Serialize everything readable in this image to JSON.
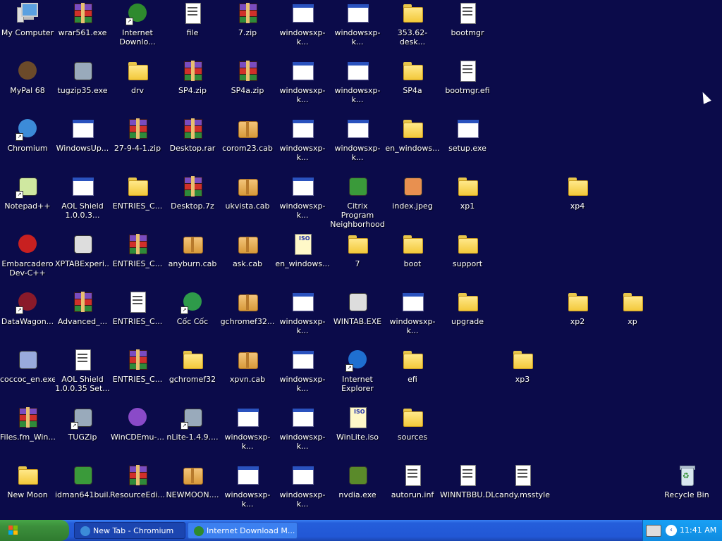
{
  "desktop": {
    "icons": [
      {
        "label": "My Computer",
        "type": "mycomp"
      },
      {
        "label": "wrar561.exe",
        "type": "rar"
      },
      {
        "label": "Internet\nDownlo...",
        "type": "circle",
        "color": "#2e8a2e",
        "shortcut": true
      },
      {
        "label": "file",
        "type": "doc"
      },
      {
        "label": "7.zip",
        "type": "rar"
      },
      {
        "label": "windowsxp-k...",
        "type": "win"
      },
      {
        "label": "windowsxp-k...",
        "type": "win"
      },
      {
        "label": "353.62-desk...",
        "type": "folder"
      },
      {
        "label": "bootmgr",
        "type": "doc"
      },
      {
        "label": "MyPal 68",
        "type": "circle",
        "color": "#6b4a2a"
      },
      {
        "label": "tugzip35.exe",
        "type": "generic",
        "color": "#9ab"
      },
      {
        "label": "drv",
        "type": "folder"
      },
      {
        "label": "SP4.zip",
        "type": "rar"
      },
      {
        "label": "SP4a.zip",
        "type": "rar"
      },
      {
        "label": "windowsxp-k...",
        "type": "win"
      },
      {
        "label": "windowsxp-k...",
        "type": "win"
      },
      {
        "label": "SP4a",
        "type": "folder"
      },
      {
        "label": "bootmgr.efi",
        "type": "doc"
      },
      {
        "label": "Chromium",
        "type": "circle",
        "color": "#3c8bd8",
        "shortcut": true
      },
      {
        "label": "WindowsUp...",
        "type": "win"
      },
      {
        "label": "27-9-4-1.zip",
        "type": "rar"
      },
      {
        "label": "Desktop.rar",
        "type": "rar"
      },
      {
        "label": "corom23.cab",
        "type": "cab"
      },
      {
        "label": "windowsxp-k...",
        "type": "win"
      },
      {
        "label": "windowsxp-k...",
        "type": "win"
      },
      {
        "label": "en_windows...",
        "type": "folder"
      },
      {
        "label": "setup.exe",
        "type": "win"
      },
      {
        "label": "Notepad++",
        "type": "generic",
        "color": "#cfe8a0",
        "shortcut": true
      },
      {
        "label": "AOL Shield\n1.0.0.3...",
        "type": "win"
      },
      {
        "label": "ENTRIES_C...",
        "type": "folder"
      },
      {
        "label": "Desktop.7z",
        "type": "rar"
      },
      {
        "label": "ukvista.cab",
        "type": "cab"
      },
      {
        "label": "windowsxp-k...",
        "type": "win"
      },
      {
        "label": "Citrix Program\nNeighborhood",
        "type": "generic",
        "color": "#3a9a3a"
      },
      {
        "label": "index.jpeg",
        "type": "generic",
        "color": "#e89050"
      },
      {
        "label": "xp1",
        "type": "folder"
      },
      {
        "label": "xp4",
        "type": "folder"
      },
      {
        "label": "Embarcadero\nDev-C++",
        "type": "circle",
        "color": "#c82020"
      },
      {
        "label": "XPTABExperi...",
        "type": "generic",
        "color": "#ddd"
      },
      {
        "label": "ENTRIES_C...",
        "type": "rar"
      },
      {
        "label": "anyburn.cab",
        "type": "cab"
      },
      {
        "label": "ask.cab",
        "type": "cab"
      },
      {
        "label": "en_windows...",
        "type": "iso"
      },
      {
        "label": "7",
        "type": "folder"
      },
      {
        "label": "boot",
        "type": "folder"
      },
      {
        "label": "support",
        "type": "folder"
      },
      {
        "label": "DataWagon...",
        "type": "circle",
        "color": "#8a1a2a",
        "shortcut": true
      },
      {
        "label": "Advanced_...",
        "type": "rar"
      },
      {
        "label": "ENTRIES_C...",
        "type": "doc"
      },
      {
        "label": "Cốc Cốc",
        "type": "circle",
        "color": "#2e9a4a",
        "shortcut": true
      },
      {
        "label": "gchromef32...",
        "type": "cab"
      },
      {
        "label": "windowsxp-k...",
        "type": "win"
      },
      {
        "label": "WINTAB.EXE",
        "type": "generic",
        "color": "#ddd"
      },
      {
        "label": "windowsxp-k...",
        "type": "win"
      },
      {
        "label": "upgrade",
        "type": "folder"
      },
      {
        "label": "xp2",
        "type": "folder"
      },
      {
        "label": "xp",
        "type": "folder"
      },
      {
        "label": "coccoc_en.exe",
        "type": "generic",
        "color": "#9ad"
      },
      {
        "label": "AOL Shield\n1.0.0.35 Set...",
        "type": "doc"
      },
      {
        "label": "ENTRIES_C...",
        "type": "rar"
      },
      {
        "label": "gchromef32",
        "type": "folder"
      },
      {
        "label": "xpvn.cab",
        "type": "cab"
      },
      {
        "label": "windowsxp-k...",
        "type": "win"
      },
      {
        "label": "Internet\nExplorer",
        "type": "circle",
        "color": "#1f6fd0",
        "shortcut": true
      },
      {
        "label": "efi",
        "type": "folder"
      },
      {
        "label": "xp3",
        "type": "folder"
      },
      {
        "label": "Files.fm_Win...",
        "type": "rar"
      },
      {
        "label": "TUGZip",
        "type": "generic",
        "color": "#9ab",
        "shortcut": true
      },
      {
        "label": "WinCDEmu-...",
        "type": "circle",
        "color": "#8a4ac8"
      },
      {
        "label": "nLite-1.4.9....",
        "type": "generic",
        "color": "#9ab",
        "shortcut": true
      },
      {
        "label": "windowsxp-k...",
        "type": "win"
      },
      {
        "label": "windowsxp-k...",
        "type": "win"
      },
      {
        "label": "WinLite.iso",
        "type": "iso"
      },
      {
        "label": "sources",
        "type": "folder"
      },
      {
        "label": "New Moon",
        "type": "folder"
      },
      {
        "label": "idman641buil...",
        "type": "generic",
        "color": "#3a9a3a"
      },
      {
        "label": "ResourceEdi...",
        "type": "rar"
      },
      {
        "label": "NEWMOON....",
        "type": "cab"
      },
      {
        "label": "windowsxp-k...",
        "type": "win"
      },
      {
        "label": "windowsxp-k...",
        "type": "win"
      },
      {
        "label": "nvdia.exe",
        "type": "generic",
        "color": "#5a8a2a"
      },
      {
        "label": "autorun.inf",
        "type": "doc"
      },
      {
        "label": "WINNTBBU.DLL",
        "type": "doc"
      },
      {
        "label": "candy.msstyles",
        "type": "doc"
      },
      {
        "label": "Recycle Bin",
        "type": "recycle"
      }
    ]
  },
  "taskbar": {
    "start_label": "start",
    "tasks": [
      {
        "label": "New Tab - Chromium",
        "icon_color": "#3c8bd8",
        "active": true
      },
      {
        "label": "Internet Download M...",
        "icon_color": "#2e8a2e",
        "active": false
      }
    ],
    "clock": "11:41 AM"
  }
}
